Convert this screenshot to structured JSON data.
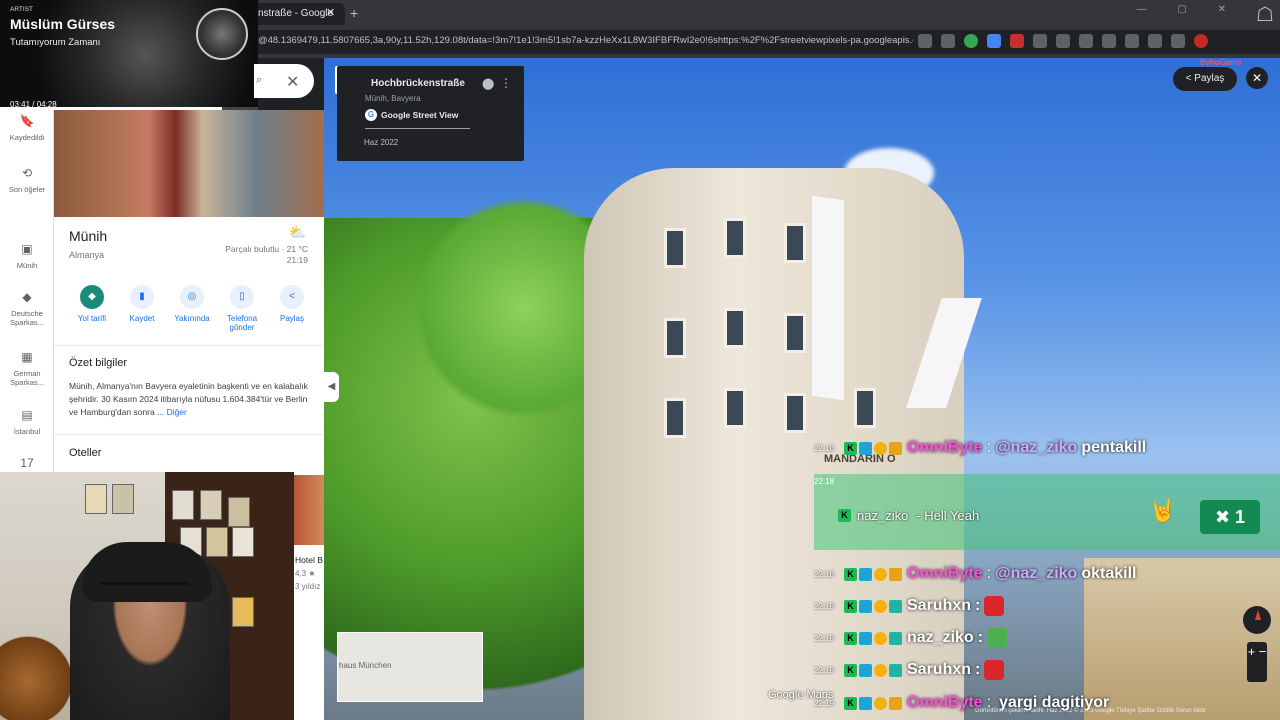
{
  "browser": {
    "tab_title": "nstraße - Google",
    "tab_close": "✕",
    "new_tab": "+",
    "url": "@48.1369479,11.5807665,3a,90y,11.52h,129.08t/data=!3m7!1e1!3m5!1sb7a-kzzHeXx1L8W3IFBFRwI2e0!6shttps:%2F%2Fstreetviewpixels-pa.googleapis.co...",
    "window_controls": "— ▢ ✕"
  },
  "music": {
    "label": "ARTIST",
    "artist": "Müslüm Gürses",
    "song": "Tutamıyorum Zamanı",
    "time": "03:41 / 04:28",
    "progress": 0.86
  },
  "maps_rail": [
    {
      "label": "Kaydedildi",
      "icon": "bookmark-icon",
      "glyph": "🔖"
    },
    {
      "label": "Son öğeler",
      "icon": "history-icon",
      "glyph": "⟲"
    },
    {
      "label": "Münih",
      "icon": "city-icon",
      "glyph": "▣"
    },
    {
      "label": "Deutsche Sparkas...",
      "icon": "bank-icon",
      "glyph": "◆"
    },
    {
      "label": "German Sparkas...",
      "icon": "building-icon",
      "glyph": "▦"
    },
    {
      "label": "İstanbul",
      "icon": "istanbul-icon",
      "glyph": "▤"
    },
    {
      "label": "",
      "icon": "calendar-icon",
      "glyph": "17"
    }
  ],
  "search": {
    "close": "✕",
    "icon": "⌕"
  },
  "place": {
    "name": "Münih",
    "country": "Almanya",
    "weather": "Parçalı bulutlu · 21 °C",
    "weather_time": "21:19",
    "weather_icon": "⛅"
  },
  "actions": [
    {
      "label": "Yol tarifi",
      "glyph": "◆"
    },
    {
      "label": "Kaydet",
      "glyph": "▮"
    },
    {
      "label": "Yakınında",
      "glyph": "◎"
    },
    {
      "label": "Telefona gönder",
      "glyph": "▯"
    },
    {
      "label": "Paylaş",
      "glyph": "<"
    }
  ],
  "summary": {
    "title": "Özet bilgiler",
    "text": "Münih, Almanya'nın Bavyera eyaletinin başkenti ve en kalabalık şehridir. 30 Kasım 2024 itibarıyla nüfusu 1.604.384'tür ve Berlin ve Hamburg'dan sonra ...",
    "more": "Diğer"
  },
  "hotels": {
    "title": "Oteller",
    "name": "Hotel B",
    "rating": "4,3 ★",
    "years": "3 yıldız"
  },
  "streetview": {
    "title": "Hochbrückenstraße",
    "subtitle": "Münih, Bavyera",
    "source": "Google Street View",
    "date": "Haz 2022",
    "share": "Paylaş",
    "close": "✕",
    "sign": "MANDARIN O",
    "minimap_label": "haus München",
    "zoom": "+ −",
    "logo": "Google Maps",
    "footer": "Görüntünün çekilme tarihi: Haz 2022   © 2025 Google   Türkiye   Şartlar   Gizlilik   Sorun bildir",
    "watermark": "ByNoGame"
  },
  "chat": {
    "highlight": {
      "ts": "22:18",
      "user": "naz_ziko",
      "text": "- Hell Yeah",
      "count": "1",
      "count_icon": "✖",
      "emote": "🤘"
    },
    "messages": [
      {
        "ts": "22:18",
        "user": "OmniByte",
        "user_color": "#ff4fd8",
        "badges": [
          "k",
          "blue",
          "gold",
          "crown"
        ],
        "mention": "@naz_ziko",
        "text": "pentakill"
      },
      {
        "ts": "22:18",
        "user": "OmniByte",
        "user_color": "#ff4fd8",
        "badges": [
          "k",
          "blue",
          "gold",
          "crown"
        ],
        "mention": "@naz_ziko",
        "text": "oktakill"
      },
      {
        "ts": "22:19",
        "user": "Saruhxn",
        "user_color": "#ffffff",
        "badges": [
          "k",
          "blue",
          "gold",
          "teal"
        ],
        "mention": "",
        "text": ":",
        "emote_color": "#d8262b"
      },
      {
        "ts": "22:19",
        "user": "naz_ziko",
        "user_color": "#ffffff",
        "badges": [
          "k",
          "blue",
          "gold",
          "teal"
        ],
        "mention": "",
        "text": ":",
        "emote_color": "#4caf50"
      },
      {
        "ts": "22:19",
        "user": "Saruhxn",
        "user_color": "#ffffff",
        "badges": [
          "k",
          "blue",
          "gold",
          "teal"
        ],
        "mention": "",
        "text": ":",
        "emote_color": "#d8262b"
      },
      {
        "ts": "22:19",
        "user": "OmniByte",
        "user_color": "#ff4fd8",
        "badges": [
          "k",
          "blue",
          "gold",
          "crown"
        ],
        "mention": "",
        "text": "yargi dagitiyor"
      }
    ]
  },
  "colors": {
    "accent": "#1a73e8",
    "highlight": "#43c47a",
    "omnibyte": "#ff4fd8"
  }
}
